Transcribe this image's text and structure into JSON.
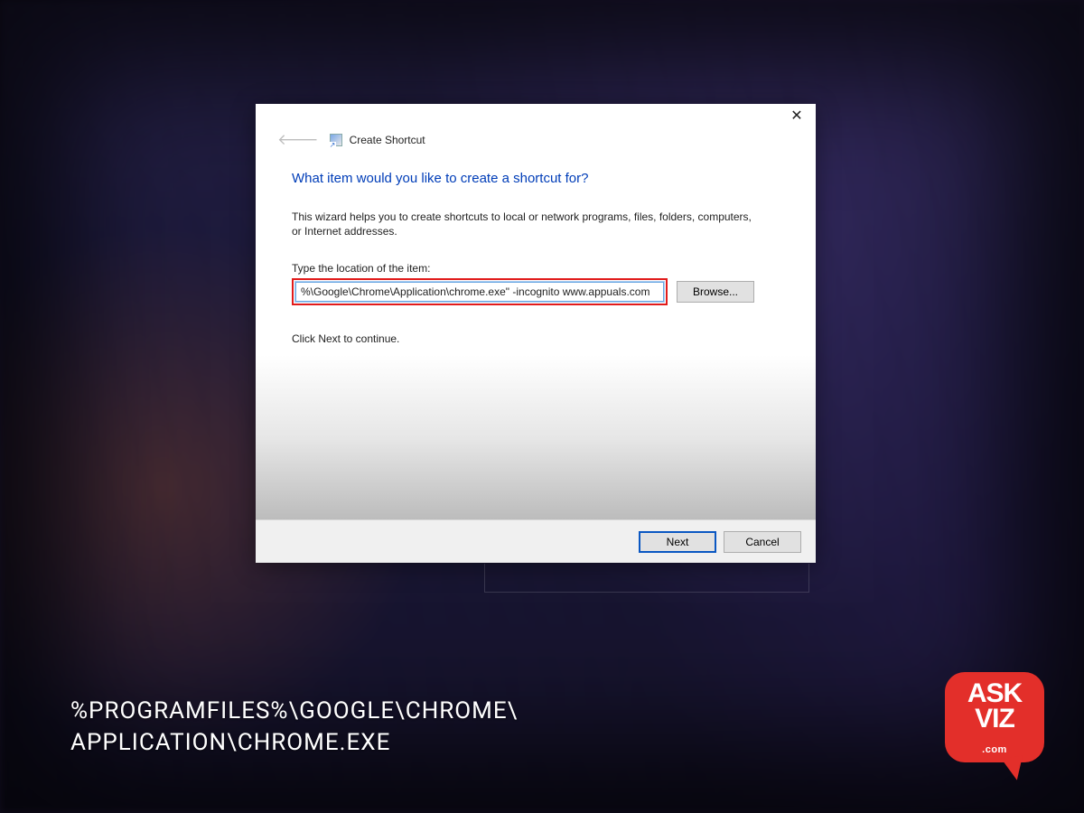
{
  "dialog": {
    "title": "Create Shortcut",
    "heading": "What item would you like to create a shortcut for?",
    "description": "This wizard helps you to create shortcuts to local or network programs, files, folders, computers, or Internet addresses.",
    "field_label": "Type the location of the item:",
    "location_value": "%\\Google\\Chrome\\Application\\chrome.exe\" -incognito www.appuals.com",
    "browse_label": "Browse...",
    "continue_text": "Click Next to continue.",
    "next_label": "Next",
    "cancel_label": "Cancel"
  },
  "caption": {
    "line1": "%PROGRAMFILES%\\GOOGLE\\CHROME\\",
    "line2": "APPLICATION\\CHROME.EXE"
  },
  "logo": {
    "line1": "ASK",
    "line2": "VIZ",
    "sub": ".com"
  }
}
